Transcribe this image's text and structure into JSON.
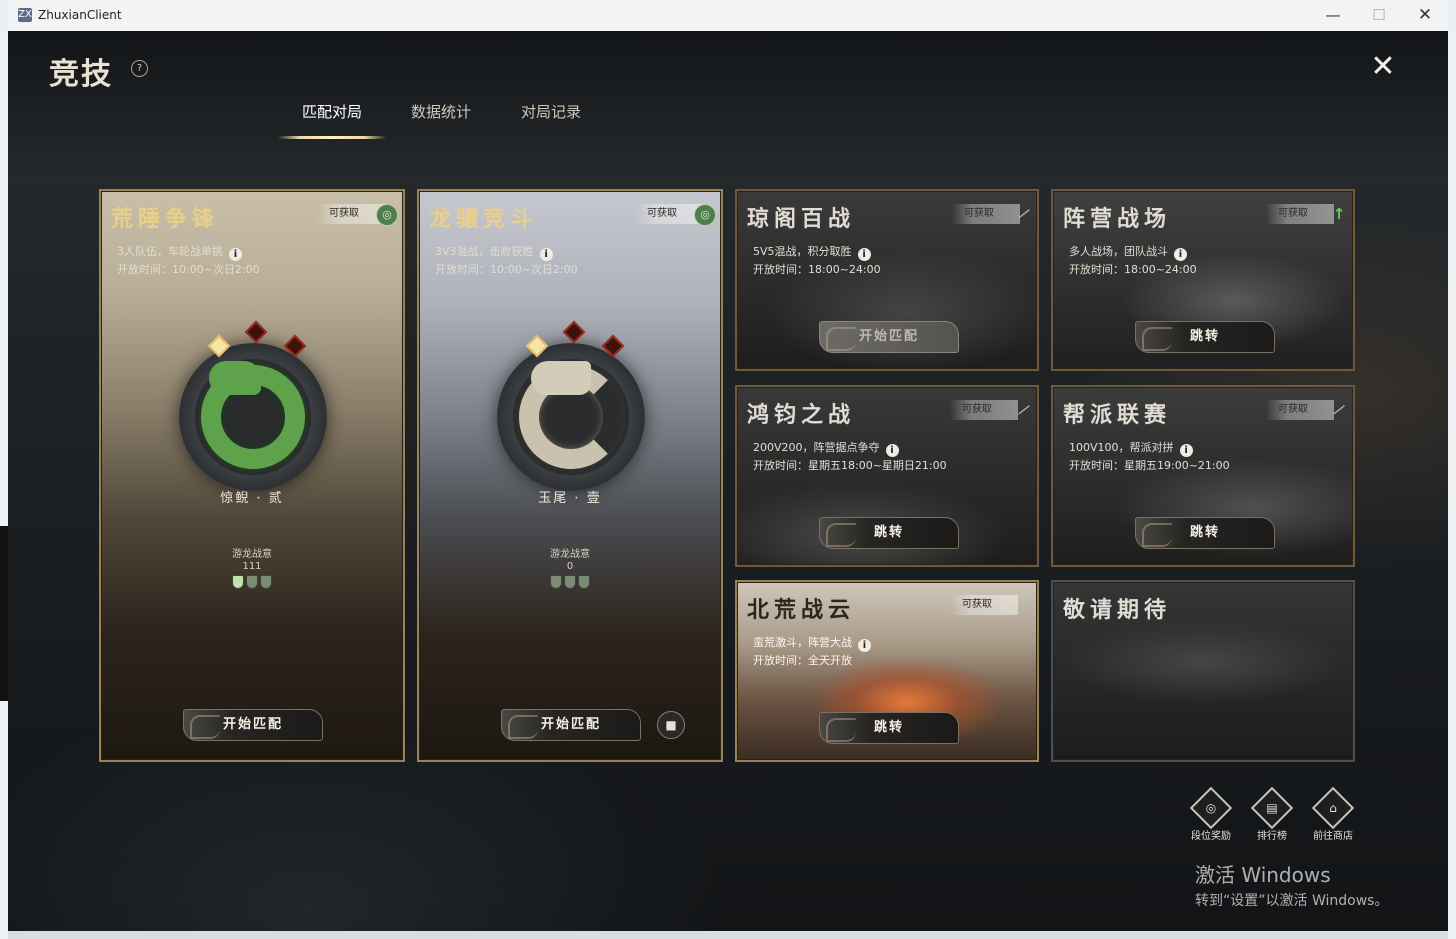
{
  "window": {
    "app_icon": "ZX",
    "title": "ZhuxianClient",
    "min": "—",
    "max": "☐",
    "close": "✕"
  },
  "header": {
    "title": "竞技",
    "help": "?",
    "close": "✕"
  },
  "tabs": [
    {
      "label": "匹配对局",
      "active": true
    },
    {
      "label": "数据统计",
      "active": false
    },
    {
      "label": "对局记录",
      "active": false
    }
  ],
  "modes": {
    "huangjing": {
      "title": "荒陲争锋",
      "badge": "可获取",
      "desc": "3人队伍，车轮战单挑",
      "time": "开放时间：10:00~次日2:00",
      "emblem_name": "惊鲵 · 贰",
      "rank_label": "游龙战意",
      "rank_value": "111",
      "button": "开始匹配"
    },
    "longxiang": {
      "title": "龙骧竞斗",
      "badge": "可获取",
      "desc": "3V3混战，击败获胜",
      "time": "开放时间：10:00~次日2:00",
      "emblem_name": "玉尾 · 壹",
      "rank_label": "游龙战意",
      "rank_value": "0",
      "button": "开始匹配",
      "video_icon": "■"
    },
    "qiongge": {
      "title": "琼阁百战",
      "badge": "可获取",
      "desc": "5V5混战，积分取胜",
      "time": "开放时间：18:00~24:00",
      "button": "开始匹配",
      "button_disabled": true
    },
    "zhenying": {
      "title": "阵营战场",
      "badge": "可获取",
      "desc": "多人战场，团队战斗",
      "time": "开放时间：18:00~24:00",
      "button": "跳转"
    },
    "hongjun": {
      "title": "鸿钧之战",
      "badge": "可获取",
      "desc": "200V200，阵营据点争夺",
      "time": "开放时间：星期五18:00~星期日21:00",
      "button": "跳转"
    },
    "bangpai": {
      "title": "帮派联赛",
      "badge": "可获取",
      "desc": "100V100，帮派对拼",
      "time": "开放时间：星期五19:00~21:00",
      "button": "跳转"
    },
    "beihuang": {
      "title": "北荒战云",
      "badge": "可获取",
      "desc": "蛮荒激斗，阵营大战",
      "time": "开放时间：全天开放",
      "button": "跳转"
    },
    "coming": {
      "title": "敬请期待"
    }
  },
  "shortcuts": [
    {
      "label": "段位奖励",
      "icon": "medal-icon",
      "glyph": "◎"
    },
    {
      "label": "排行榜",
      "icon": "scroll-icon",
      "glyph": "▤"
    },
    {
      "label": "前往商店",
      "icon": "shop-icon",
      "glyph": "⌂"
    }
  ],
  "watermark": {
    "line1": "激活 Windows",
    "line2": "转到“设置”以激活 Windows。"
  },
  "colors": {
    "tall_card_border": "#9a8257",
    "title_gold": "#e9cf8a",
    "jade_green": "#5ea34c",
    "silver": "#c9c2ae"
  }
}
